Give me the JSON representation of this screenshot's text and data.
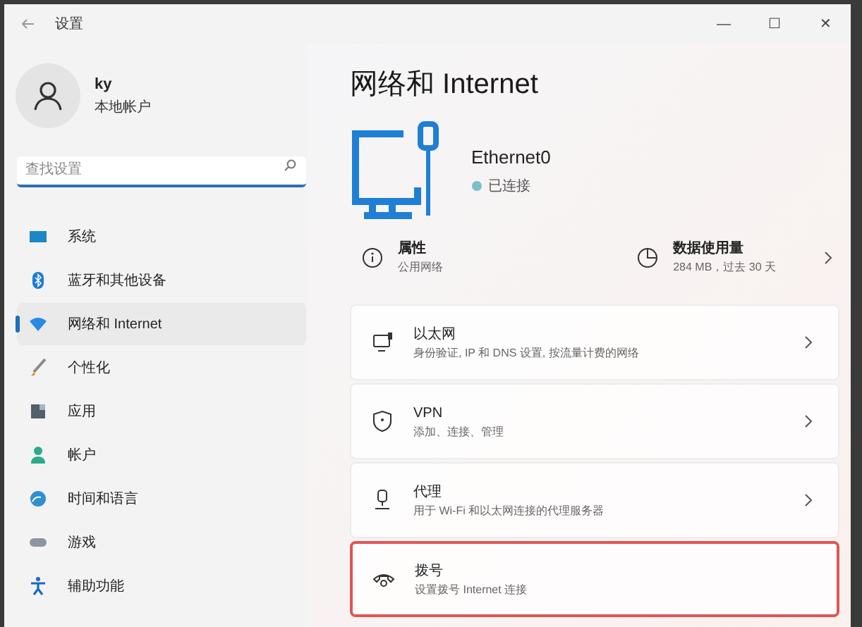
{
  "window": {
    "title": "设置",
    "controls": [
      "—",
      "☐",
      "✕"
    ]
  },
  "account": {
    "name": "ky",
    "type": "本地帐户"
  },
  "search": {
    "placeholder": "查找设置"
  },
  "sidebar": {
    "items": [
      {
        "label": "系统",
        "selected": false
      },
      {
        "label": "蓝牙和其他设备",
        "selected": false
      },
      {
        "label": "网络和 Internet",
        "selected": true
      },
      {
        "label": "个性化",
        "selected": false
      },
      {
        "label": "应用",
        "selected": false
      },
      {
        "label": "帐户",
        "selected": false
      },
      {
        "label": "时间和语言",
        "selected": false
      },
      {
        "label": "游戏",
        "selected": false
      },
      {
        "label": "辅助功能",
        "selected": false
      }
    ]
  },
  "page": {
    "title": "网络和 Internet",
    "connection": {
      "name": "Ethernet0",
      "status": "已连接"
    },
    "summary": [
      {
        "title": "属性",
        "subtitle": "公用网络",
        "chevron": false
      },
      {
        "title": "数据使用量",
        "subtitle": "284 MB，过去 30 天",
        "chevron": true
      }
    ],
    "cards": [
      {
        "title": "以太网",
        "subtitle": "身份验证, IP 和 DNS 设置, 按流量计费的网络",
        "highlighted": false
      },
      {
        "title": "VPN",
        "subtitle": "添加、连接、管理",
        "highlighted": false
      },
      {
        "title": "代理",
        "subtitle": "用于 Wi-Fi 和以太网连接的代理服务器",
        "highlighted": false
      },
      {
        "title": "拨号",
        "subtitle": "设置拨号 Internet 连接",
        "highlighted": true
      }
    ]
  }
}
